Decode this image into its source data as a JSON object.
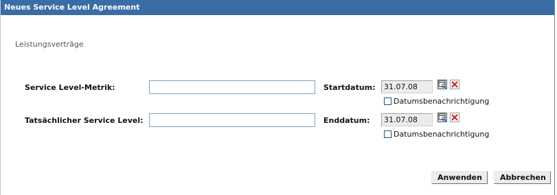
{
  "dialog": {
    "title": "Neues Service Level Agreement",
    "section_label": "Leistungsverträge"
  },
  "form": {
    "metric_label": "Service Level-Metrik:",
    "metric_value": "",
    "actual_label": "Tatsächlicher Service Level:",
    "actual_value": "",
    "start_label": "Startdatum:",
    "start_date": "31.07.08",
    "start_notify_label": "Datumsbenachrichtigung",
    "start_notify_checked": false,
    "end_label": "Enddatum:",
    "end_date": "31.07.08",
    "end_notify_label": "Datumsbenachrichtigung",
    "end_notify_checked": false
  },
  "buttons": {
    "apply": "Anwenden",
    "cancel": "Abbrechen"
  },
  "colors": {
    "titlebar": "#3a6da6",
    "delete_icon": "#d42020"
  },
  "icons": {
    "calendar": "calendar-icon",
    "delete": "delete-icon"
  }
}
